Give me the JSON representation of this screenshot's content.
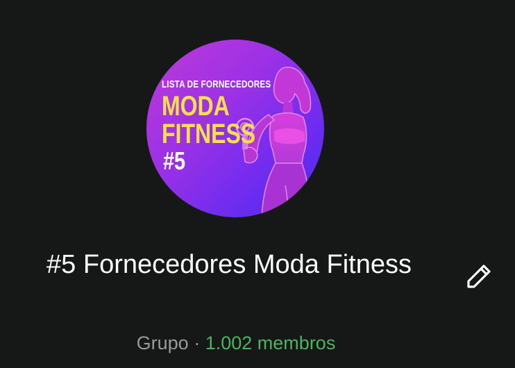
{
  "group": {
    "avatar": {
      "line1": "LISTA DE FORNECEDORES",
      "line2": "MODA",
      "line3": "FITNESS",
      "line4": "#5"
    },
    "title": "#5 Fornecedores Moda Fitness",
    "kind": "Grupo",
    "separator": "·",
    "members": "1.002 membros"
  },
  "colors": {
    "background": "#161717",
    "title_text": "#ffffff",
    "muted_text": "#9a9a9a",
    "members_accent": "#4fb45f",
    "cover_yellow": "#f7e04a"
  },
  "icons": {
    "edit": "pencil-icon"
  }
}
